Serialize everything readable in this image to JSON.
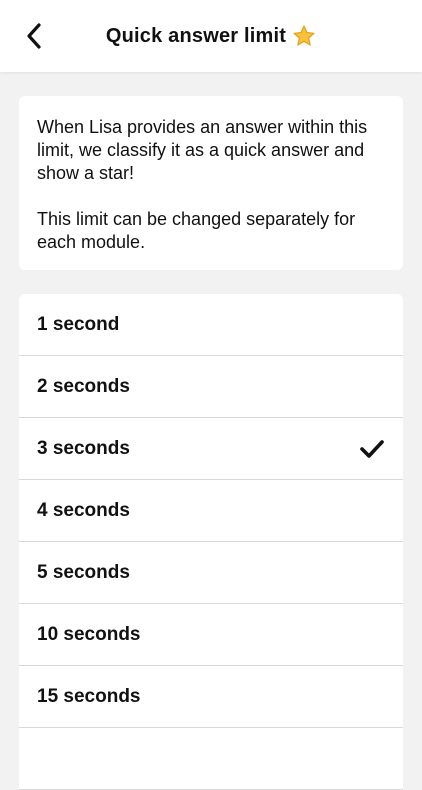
{
  "header": {
    "title": "Quick answer limit",
    "back_icon": "chevron-left-icon",
    "title_icon": "star-icon"
  },
  "info": {
    "paragraph1": "When Lisa provides an answer within this limit, we classify it as a quick answer and show a star!",
    "paragraph2": "This limit can be changed separately for each module."
  },
  "options": {
    "items": [
      {
        "label": "1 second",
        "selected": false
      },
      {
        "label": "2 seconds",
        "selected": false
      },
      {
        "label": "3 seconds",
        "selected": true
      },
      {
        "label": "4 seconds",
        "selected": false
      },
      {
        "label": "5 seconds",
        "selected": false
      },
      {
        "label": "10 seconds",
        "selected": false
      },
      {
        "label": "15 seconds",
        "selected": false
      },
      {
        "label": "",
        "selected": false
      }
    ]
  },
  "colors": {
    "background": "#f2f2f2",
    "star_fill": "#f8c33a",
    "star_stroke": "#e0a020"
  }
}
